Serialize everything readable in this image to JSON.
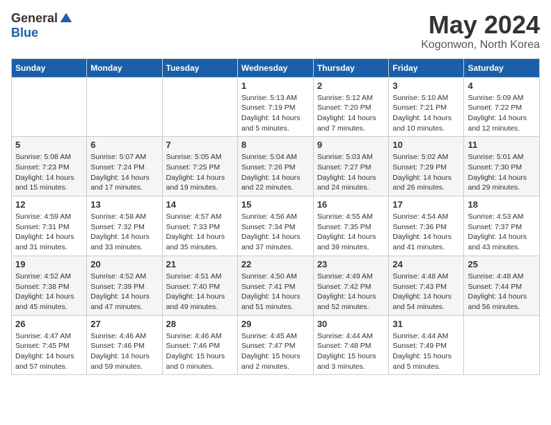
{
  "logo": {
    "general": "General",
    "blue": "Blue"
  },
  "title": "May 2024",
  "location": "Kogonwon, North Korea",
  "weekdays": [
    "Sunday",
    "Monday",
    "Tuesday",
    "Wednesday",
    "Thursday",
    "Friday",
    "Saturday"
  ],
  "weeks": [
    [
      {
        "day": "",
        "info": ""
      },
      {
        "day": "",
        "info": ""
      },
      {
        "day": "",
        "info": ""
      },
      {
        "day": "1",
        "info": "Sunrise: 5:13 AM\nSunset: 7:19 PM\nDaylight: 14 hours\nand 5 minutes."
      },
      {
        "day": "2",
        "info": "Sunrise: 5:12 AM\nSunset: 7:20 PM\nDaylight: 14 hours\nand 7 minutes."
      },
      {
        "day": "3",
        "info": "Sunrise: 5:10 AM\nSunset: 7:21 PM\nDaylight: 14 hours\nand 10 minutes."
      },
      {
        "day": "4",
        "info": "Sunrise: 5:09 AM\nSunset: 7:22 PM\nDaylight: 14 hours\nand 12 minutes."
      }
    ],
    [
      {
        "day": "5",
        "info": "Sunrise: 5:08 AM\nSunset: 7:23 PM\nDaylight: 14 hours\nand 15 minutes."
      },
      {
        "day": "6",
        "info": "Sunrise: 5:07 AM\nSunset: 7:24 PM\nDaylight: 14 hours\nand 17 minutes."
      },
      {
        "day": "7",
        "info": "Sunrise: 5:05 AM\nSunset: 7:25 PM\nDaylight: 14 hours\nand 19 minutes."
      },
      {
        "day": "8",
        "info": "Sunrise: 5:04 AM\nSunset: 7:26 PM\nDaylight: 14 hours\nand 22 minutes."
      },
      {
        "day": "9",
        "info": "Sunrise: 5:03 AM\nSunset: 7:27 PM\nDaylight: 14 hours\nand 24 minutes."
      },
      {
        "day": "10",
        "info": "Sunrise: 5:02 AM\nSunset: 7:29 PM\nDaylight: 14 hours\nand 26 minutes."
      },
      {
        "day": "11",
        "info": "Sunrise: 5:01 AM\nSunset: 7:30 PM\nDaylight: 14 hours\nand 29 minutes."
      }
    ],
    [
      {
        "day": "12",
        "info": "Sunrise: 4:59 AM\nSunset: 7:31 PM\nDaylight: 14 hours\nand 31 minutes."
      },
      {
        "day": "13",
        "info": "Sunrise: 4:58 AM\nSunset: 7:32 PM\nDaylight: 14 hours\nand 33 minutes."
      },
      {
        "day": "14",
        "info": "Sunrise: 4:57 AM\nSunset: 7:33 PM\nDaylight: 14 hours\nand 35 minutes."
      },
      {
        "day": "15",
        "info": "Sunrise: 4:56 AM\nSunset: 7:34 PM\nDaylight: 14 hours\nand 37 minutes."
      },
      {
        "day": "16",
        "info": "Sunrise: 4:55 AM\nSunset: 7:35 PM\nDaylight: 14 hours\nand 39 minutes."
      },
      {
        "day": "17",
        "info": "Sunrise: 4:54 AM\nSunset: 7:36 PM\nDaylight: 14 hours\nand 41 minutes."
      },
      {
        "day": "18",
        "info": "Sunrise: 4:53 AM\nSunset: 7:37 PM\nDaylight: 14 hours\nand 43 minutes."
      }
    ],
    [
      {
        "day": "19",
        "info": "Sunrise: 4:52 AM\nSunset: 7:38 PM\nDaylight: 14 hours\nand 45 minutes."
      },
      {
        "day": "20",
        "info": "Sunrise: 4:52 AM\nSunset: 7:39 PM\nDaylight: 14 hours\nand 47 minutes."
      },
      {
        "day": "21",
        "info": "Sunrise: 4:51 AM\nSunset: 7:40 PM\nDaylight: 14 hours\nand 49 minutes."
      },
      {
        "day": "22",
        "info": "Sunrise: 4:50 AM\nSunset: 7:41 PM\nDaylight: 14 hours\nand 51 minutes."
      },
      {
        "day": "23",
        "info": "Sunrise: 4:49 AM\nSunset: 7:42 PM\nDaylight: 14 hours\nand 52 minutes."
      },
      {
        "day": "24",
        "info": "Sunrise: 4:48 AM\nSunset: 7:43 PM\nDaylight: 14 hours\nand 54 minutes."
      },
      {
        "day": "25",
        "info": "Sunrise: 4:48 AM\nSunset: 7:44 PM\nDaylight: 14 hours\nand 56 minutes."
      }
    ],
    [
      {
        "day": "26",
        "info": "Sunrise: 4:47 AM\nSunset: 7:45 PM\nDaylight: 14 hours\nand 57 minutes."
      },
      {
        "day": "27",
        "info": "Sunrise: 4:46 AM\nSunset: 7:46 PM\nDaylight: 14 hours\nand 59 minutes."
      },
      {
        "day": "28",
        "info": "Sunrise: 4:46 AM\nSunset: 7:46 PM\nDaylight: 15 hours\nand 0 minutes."
      },
      {
        "day": "29",
        "info": "Sunrise: 4:45 AM\nSunset: 7:47 PM\nDaylight: 15 hours\nand 2 minutes."
      },
      {
        "day": "30",
        "info": "Sunrise: 4:44 AM\nSunset: 7:48 PM\nDaylight: 15 hours\nand 3 minutes."
      },
      {
        "day": "31",
        "info": "Sunrise: 4:44 AM\nSunset: 7:49 PM\nDaylight: 15 hours\nand 5 minutes."
      },
      {
        "day": "",
        "info": ""
      }
    ]
  ]
}
